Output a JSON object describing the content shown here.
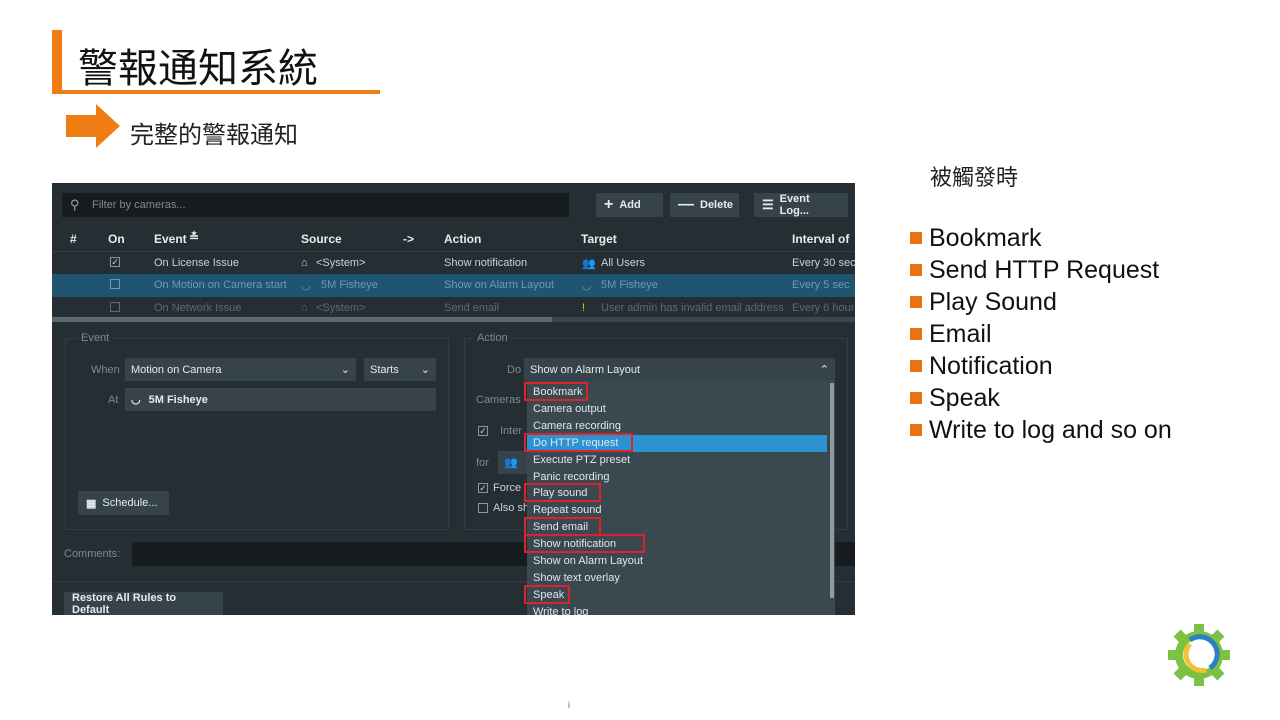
{
  "slide": {
    "title": "警報通知系統",
    "subtitle": "完整的警報通知",
    "right_heading": "被觸發時",
    "bullets": [
      "Bookmark",
      "Send HTTP Request",
      "Play Sound",
      "Email",
      "Notification",
      "Speak",
      "Write to log and so on"
    ],
    "page_marker": "i",
    "accent": "#f07d14"
  },
  "toolbar": {
    "filter_placeholder": "Filter by cameras...",
    "add": "Add",
    "delete": "Delete",
    "event_log": "Event Log..."
  },
  "table": {
    "headers": [
      "#",
      "On",
      "Event",
      "Source",
      "->",
      "Action",
      "Target",
      "Interval of"
    ],
    "rows": [
      {
        "on": true,
        "event": "On License Issue",
        "source": "<System>",
        "action": "Show notification",
        "target": "All Users",
        "interval": "Every 30 sec"
      },
      {
        "on": false,
        "event": "On Motion on Camera start",
        "source": "5M Fisheye",
        "action": "Show on Alarm Layout",
        "target": "5M Fisheye",
        "interval": "Every 5 sec"
      },
      {
        "on": false,
        "event": "On Network Issue",
        "source": "<System>",
        "action": "Send email",
        "target": "User admin has invalid email address",
        "interval": "Every 6 hour"
      }
    ]
  },
  "event_panel": {
    "title": "Event",
    "when_label": "When",
    "when_value": "Motion on Camera",
    "starts_value": "Starts",
    "at_label": "At",
    "at_value": "5M Fisheye",
    "schedule": "Schedule..."
  },
  "action_panel": {
    "title": "Action",
    "do_label": "Do",
    "do_value": "Show on Alarm Layout",
    "cameras_label": "Cameras",
    "interval_label": "Inter",
    "for_label": "for",
    "force_label": "Force",
    "also_label": "Also sh",
    "options": [
      "Bookmark",
      "Camera output",
      "Camera recording",
      "Do HTTP request",
      "Execute PTZ preset",
      "Panic recording",
      "Play sound",
      "Repeat sound",
      "Send email",
      "Show notification",
      "Show on Alarm Layout",
      "Show text overlay",
      "Speak",
      "Write to log"
    ],
    "highlighted": "Do HTTP request",
    "boxed": [
      "Bookmark",
      "Do HTTP request",
      "Play sound",
      "Send email",
      "Show notification",
      "Speak"
    ]
  },
  "footer": {
    "comments_label": "Comments:",
    "restore": "Restore All Rules to Default"
  }
}
